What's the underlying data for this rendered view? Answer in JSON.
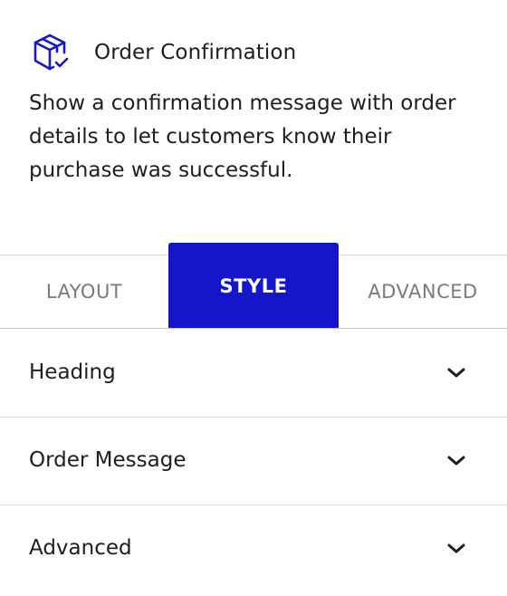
{
  "block": {
    "icon": "package-check-icon",
    "title": "Order Confirmation",
    "description_lines": [
      "Show a confirmation message with order",
      "details to let customers know their",
      "purchase was successful."
    ]
  },
  "tabs": {
    "items": [
      {
        "label": "LAYOUT",
        "active": false
      },
      {
        "label": "STYLE",
        "active": true
      },
      {
        "label": "ADVANCED",
        "active": false
      }
    ]
  },
  "sections": [
    {
      "label": "Heading",
      "icon": "chevron-down-icon"
    },
    {
      "label": "Order Message",
      "icon": "chevron-down-icon"
    },
    {
      "label": "Advanced",
      "icon": "chevron-down-icon"
    }
  ],
  "colors": {
    "accent": "#1515c9",
    "text": "#1e1e1e",
    "muted_tab": "#7a7a7a",
    "divider": "#dcdcdc"
  }
}
